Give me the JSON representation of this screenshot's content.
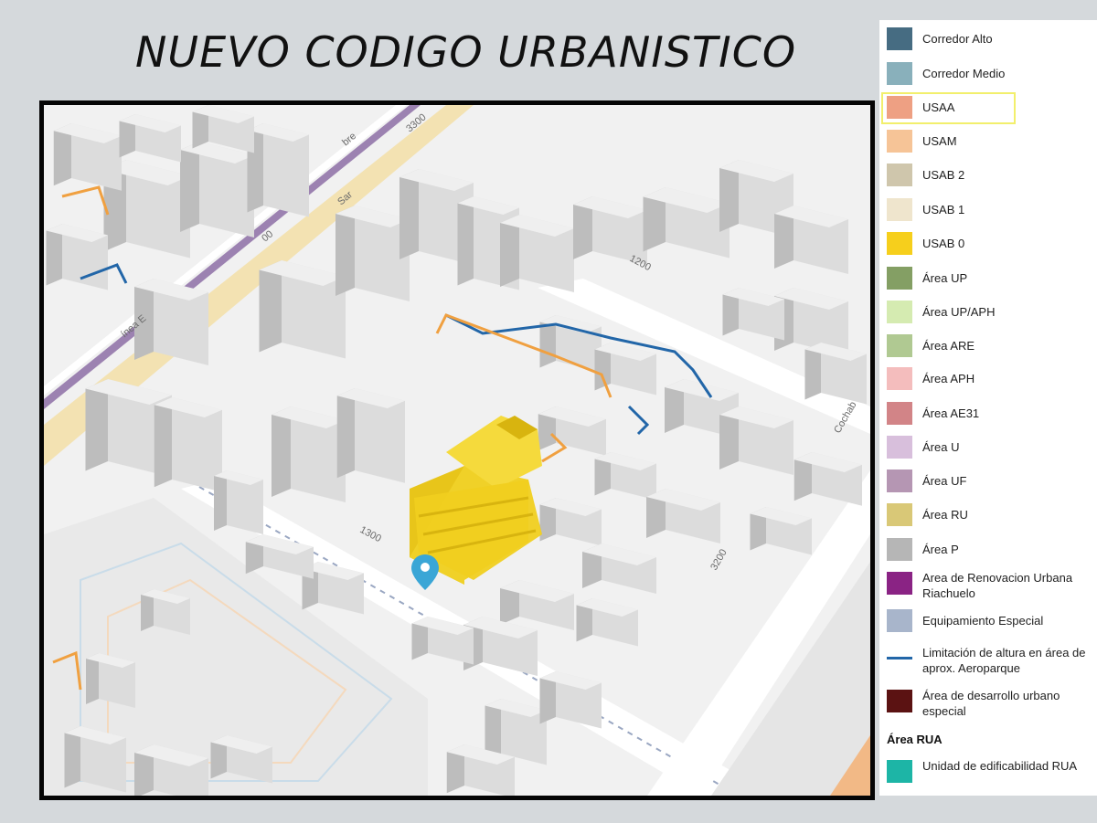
{
  "title": "NUEVO CODIGO URBANISTICO",
  "map": {
    "street_labels": [
      "3300",
      "Sar",
      "bre",
      "00",
      "ínea E",
      "1200",
      "Cochab",
      "1300",
      "3200"
    ],
    "colors": {
      "block": "#e6e6e6",
      "building_light": "#dcdcdc",
      "building_dark": "#bdbdbd",
      "highlight": "#f0cf1f",
      "highlight_dark": "#d8b40f",
      "avenue": "#f3e2b2",
      "metro_line": "#8d6fa6",
      "pin": "#3aa6d6"
    }
  },
  "legend": {
    "items": [
      {
        "label": "Corredor Alto",
        "color": "#466c82",
        "type": "box"
      },
      {
        "label": "Corredor Medio",
        "color": "#89b0bb",
        "type": "box"
      },
      {
        "label": "USAA",
        "color": "#eea083",
        "type": "box"
      },
      {
        "label": "USAM",
        "color": "#f6c497",
        "type": "box"
      },
      {
        "label": "USAB 2",
        "color": "#cfc6ac",
        "type": "box"
      },
      {
        "label": "USAB 1",
        "color": "#efe5cd",
        "type": "box"
      },
      {
        "label": "USAB 0",
        "color": "#f6cf1c",
        "type": "box"
      },
      {
        "label": "Área UP",
        "color": "#849f64",
        "type": "box"
      },
      {
        "label": "Área UP/APH",
        "color": "#d5ebb1",
        "type": "box"
      },
      {
        "label": "Área ARE",
        "color": "#b0c992",
        "type": "box"
      },
      {
        "label": "Área APH",
        "color": "#f4bdbd",
        "type": "box"
      },
      {
        "label": "Área AE31",
        "color": "#d28487",
        "type": "box"
      },
      {
        "label": "Área U",
        "color": "#d8bfdc",
        "type": "box"
      },
      {
        "label": "Área UF",
        "color": "#b596b3",
        "type": "box"
      },
      {
        "label": "Área RU",
        "color": "#d9c877",
        "type": "box"
      },
      {
        "label": "Área P",
        "color": "#b6b6b6",
        "type": "box"
      },
      {
        "label": "Area de Renovacion Urbana Riachuelo",
        "color": "#8a2384",
        "type": "box"
      },
      {
        "label": "Equipamiento Especial",
        "color": "#a8b5cb",
        "type": "box"
      },
      {
        "label": "Limitación de altura en área de aprox. Aeroparque",
        "color": "#2266a8",
        "type": "line"
      },
      {
        "label": "Área de desarrollo urbano especial",
        "color": "#5b1212",
        "type": "box"
      }
    ],
    "rua_heading": "Área RUA",
    "rua_item": {
      "label": "Unidad de edificabilidad RUA",
      "color": "#1db5a6",
      "type": "box"
    }
  }
}
